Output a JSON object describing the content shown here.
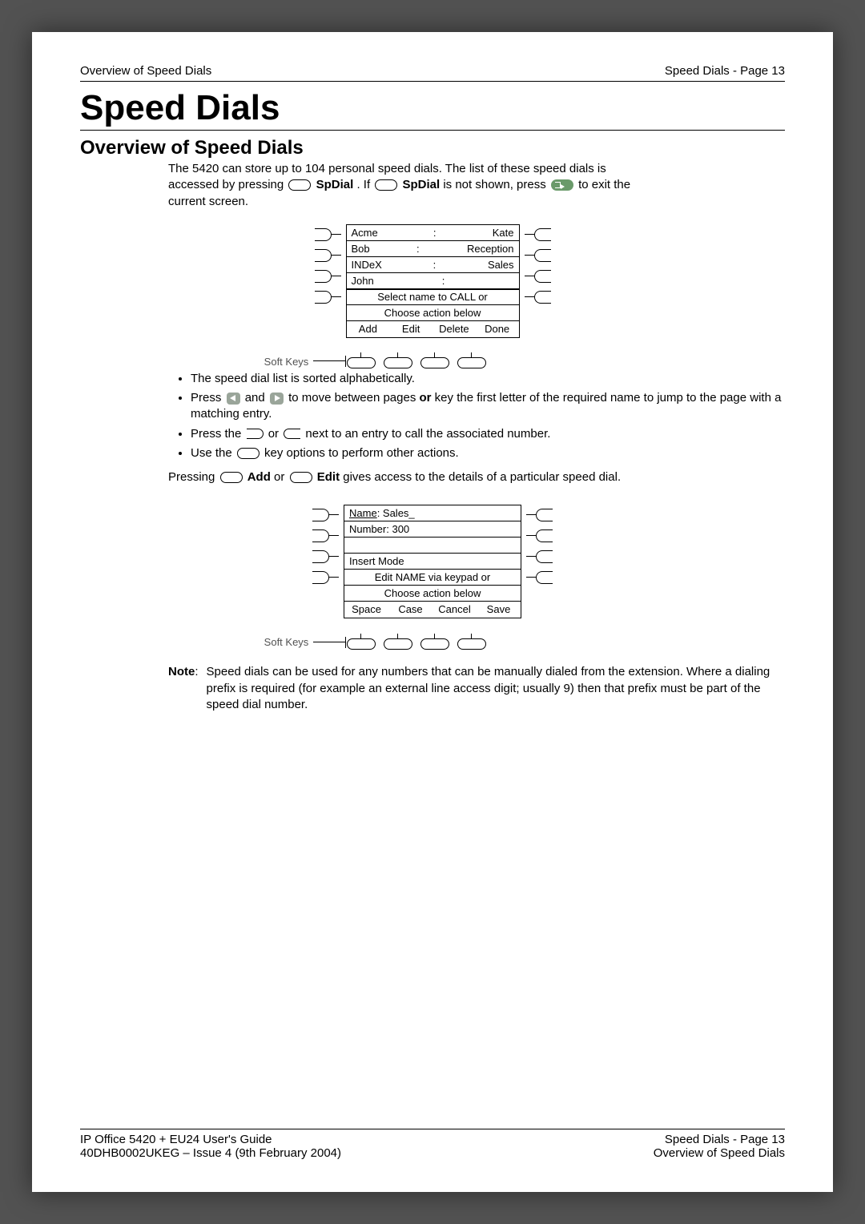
{
  "header": {
    "left": "Overview of Speed Dials",
    "right": "Speed Dials - Page 13"
  },
  "title": "Speed Dials",
  "subtitle": "Overview of Speed Dials",
  "intro": {
    "line1a": "The 5420 can store up to 104 personal speed dials. The list of these speed dials is",
    "line2a": "accessed by pressing ",
    "spdial1": " SpDial",
    "if_text": ". If ",
    "spdial2": " SpDial",
    "not_shown": " is not shown, press ",
    "exit_tail": " to exit the",
    "line3": "current screen."
  },
  "screen1": {
    "rows": [
      {
        "l": "Acme",
        "m": ":",
        "r": "Kate"
      },
      {
        "l": "Bob",
        "m": ":",
        "r": "Reception"
      },
      {
        "l": "INDeX",
        "m": ":",
        "r": "Sales"
      },
      {
        "l": "John",
        "m": ":",
        "r": ""
      }
    ],
    "msg1": "Select name to CALL or",
    "msg2": "Choose action below",
    "softkeys": [
      "Add",
      "Edit",
      "Delete",
      "Done"
    ]
  },
  "softkeys_label": "Soft Keys",
  "bullets": {
    "b1": "The speed dial list is sorted alphabetically.",
    "b2a": "Press ",
    "b2b": " and ",
    "b2c": " to move between pages ",
    "b2or": "or",
    "b2d": " key the first letter of the required name to jump to the page with a matching entry.",
    "b3a": "Press the ",
    "b3b": " or ",
    "b3c": " next to an entry to call the associated number.",
    "b4a": "Use the ",
    "b4b": " key options to perform other actions."
  },
  "pressing": {
    "a": "Pressing ",
    "add": " Add",
    "or": " or ",
    "edit": " Edit",
    "tail": " gives access to the details of a particular speed dial."
  },
  "screen2": {
    "name_label": "Name",
    "name_value": ": Sales_",
    "number_label": "Number: 300",
    "insert": "Insert Mode",
    "msg1": "Edit NAME via keypad or",
    "msg2": "Choose action below",
    "softkeys": [
      "Space",
      "Case",
      "Cancel",
      "Save"
    ]
  },
  "note": {
    "label": "Note",
    "body": "Speed dials can be used for any numbers that can be manually dialed from the extension. Where a dialing prefix is required (for example an external line access digit; usually 9) then that prefix must be part of the speed dial number."
  },
  "footer": {
    "l1": "IP Office 5420 + EU24 User's Guide",
    "r1": "Speed Dials - Page 13",
    "l2": "40DHB0002UKEG – Issue 4 (9th February 2004)",
    "r2": "Overview of Speed Dials"
  }
}
